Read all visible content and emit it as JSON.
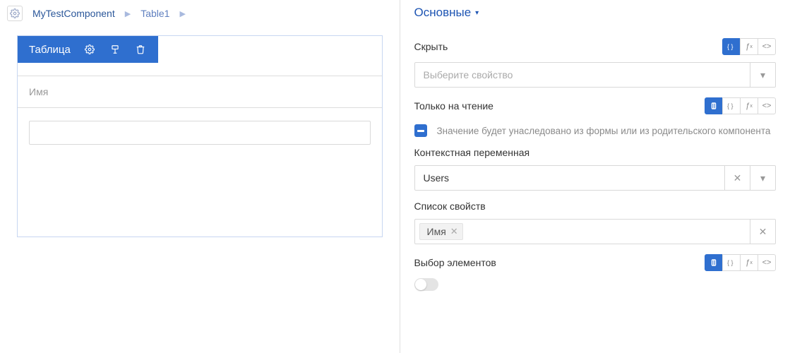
{
  "breadcrumb": {
    "items": [
      "MyTestComponent",
      "Table1"
    ]
  },
  "table_card": {
    "title": "Таблица",
    "column_header": "Имя"
  },
  "props_panel": {
    "section_title": "Основные",
    "hide": {
      "label": "Скрыть",
      "placeholder": "Выберите свойство",
      "modes": [
        "expr",
        "fx",
        "code"
      ],
      "active_mode": 0
    },
    "readonly": {
      "label": "Только на чтение",
      "inherit_text": "Значение будет унаследовано из формы или из родительского компонента",
      "inherit_checked": "indeterminate",
      "modes": [
        "link",
        "expr",
        "fx",
        "code"
      ],
      "active_mode": 0
    },
    "context_var": {
      "label": "Контекстная переменная",
      "value": "Users"
    },
    "prop_list": {
      "label": "Список свойств",
      "tags": [
        "Имя"
      ]
    },
    "selection": {
      "label": "Выбор элементов",
      "value": false,
      "modes": [
        "link",
        "expr",
        "fx",
        "code"
      ],
      "active_mode": 0
    }
  }
}
